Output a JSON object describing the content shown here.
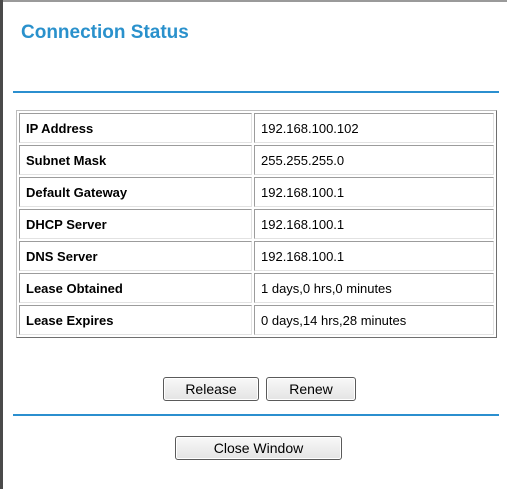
{
  "page": {
    "title": "Connection Status"
  },
  "status_rows": [
    {
      "label": "IP Address",
      "value": "192.168.100.102"
    },
    {
      "label": "Subnet Mask",
      "value": "255.255.255.0"
    },
    {
      "label": "Default Gateway",
      "value": "192.168.100.1"
    },
    {
      "label": "DHCP Server",
      "value": "192.168.100.1"
    },
    {
      "label": "DNS Server",
      "value": "192.168.100.1"
    },
    {
      "label": "Lease Obtained",
      "value": "1 days,0 hrs,0 minutes"
    },
    {
      "label": "Lease Expires",
      "value": "0 days,14 hrs,28 minutes"
    }
  ],
  "buttons": {
    "release": "Release",
    "renew": "Renew",
    "close": "Close Window"
  },
  "colors": {
    "accent": "#2a91cc",
    "rule": "#2b8fcf"
  }
}
